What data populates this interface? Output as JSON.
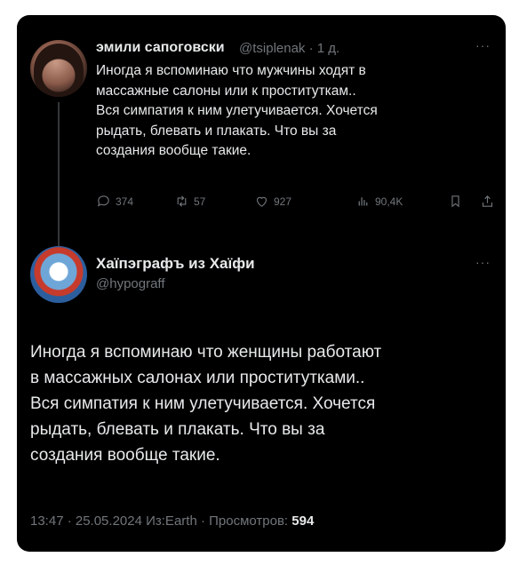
{
  "reply_tweet": {
    "author_name": "эмили сапоговски",
    "handle_time": "@tsiplenak · 1 д.",
    "more": "···",
    "text_lines": [
      "Иногда я вспоминаю что мужчины ходят в",
      "массажные салоны или к проституткам..",
      "Вся симпатия к ним улетучивается. Хочется",
      "рыдать, блевать и плакать. Что вы за",
      "создания вообще такие."
    ],
    "actions": {
      "replies": "374",
      "reposts": "57",
      "likes": "927",
      "views": "90,4K"
    }
  },
  "main_tweet": {
    "author_name": "Хаïпэграфъ из Хаïфи",
    "handle": "@hypograff",
    "more": "···",
    "text_lines": [
      "Иногда я вспоминаю что женщины работают",
      "в массажных салонах или проститутками..",
      "Вся симпатия к ним улетучивается. Хочется",
      "рыдать, блевать и плакать. Что вы за",
      "создания вообще такие."
    ],
    "meta_prefix": "13:47 · 25.05.2024 Из:Earth · Просмотров: ",
    "views_count": "594"
  },
  "colors": {
    "background": "#000000",
    "text": "#e7e9ea",
    "secondary": "#71767b"
  },
  "icons": [
    "reply-icon",
    "repost-icon",
    "like-icon",
    "views-icon",
    "bookmark-icon",
    "share-icon"
  ]
}
